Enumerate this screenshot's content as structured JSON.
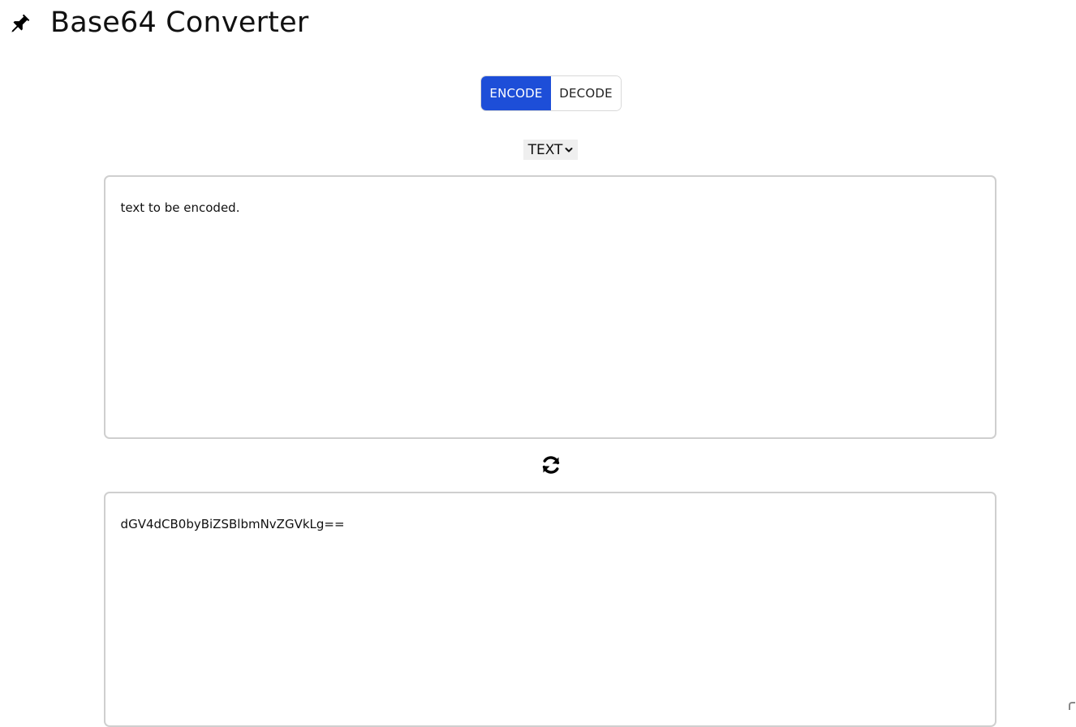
{
  "header": {
    "title": "Base64 Converter",
    "icon": "pin-icon"
  },
  "mode_toggle": {
    "encode_label": "ENCODE",
    "decode_label": "DECODE",
    "active": "ENCODE",
    "active_color": "#1d4ed8"
  },
  "format_select": {
    "value": "TEXT"
  },
  "input": {
    "value": "text to be encoded."
  },
  "swap": {
    "icon": "refresh-icon"
  },
  "output": {
    "value": "dGV4dCB0byBiZSBlbmNvZGVkLg=="
  }
}
